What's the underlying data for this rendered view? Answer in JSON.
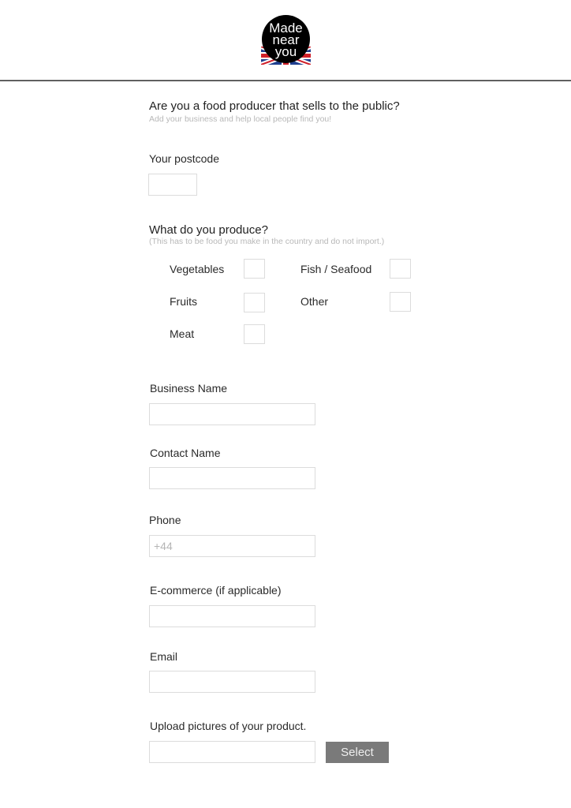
{
  "header": {
    "logo": {
      "lines": [
        "Made",
        "near",
        "you"
      ],
      "colors": {
        "circle": "#000000",
        "text": "#ffffff",
        "flag_blue": "#1f3f8f",
        "flag_red": "#d0202a"
      }
    }
  },
  "intro": {
    "title": "Are you a  food producer that sells to the public?",
    "subtitle": "Add your business and help local people find you!"
  },
  "postcode": {
    "label": "Your postcode",
    "value": "",
    "placeholder": ""
  },
  "produce": {
    "title": "What do you produce?",
    "note": "(This has to be food you make in the country and do not import.)",
    "options": [
      {
        "label": "Vegetables",
        "checked": false
      },
      {
        "label": "Fruits",
        "checked": false
      },
      {
        "label": "Meat",
        "checked": false
      },
      {
        "label": "Fish / Seafood",
        "checked": false
      },
      {
        "label": "Other",
        "checked": false
      }
    ]
  },
  "fields": {
    "business_name": {
      "label": "Business Name",
      "value": "",
      "placeholder": ""
    },
    "contact_name": {
      "label": "Contact Name",
      "value": "",
      "placeholder": ""
    },
    "phone": {
      "label": "Phone",
      "value": "",
      "placeholder": "+44"
    },
    "ecommerce": {
      "label": "E-commerce (if applicable)",
      "value": "",
      "placeholder": ""
    },
    "email": {
      "label": "Email",
      "value": "",
      "placeholder": ""
    }
  },
  "upload": {
    "label": "Upload pictures of your product.",
    "value": "",
    "button_label": "Select",
    "button_color": "#7a7a7a"
  }
}
